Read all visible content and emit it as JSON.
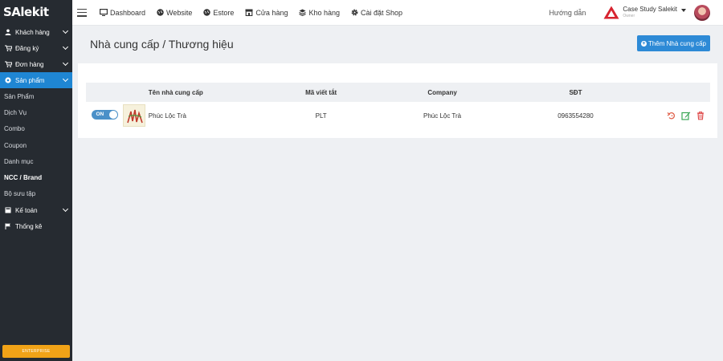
{
  "app": {
    "logo": "SAlekit"
  },
  "sidebar": {
    "items": [
      {
        "label": "Khách hàng",
        "icon": "user-icon"
      },
      {
        "label": "Đăng ký",
        "icon": "cart-icon"
      },
      {
        "label": "Đơn hàng",
        "icon": "cart-icon"
      },
      {
        "label": "Sản phẩm",
        "icon": "tag-icon",
        "active": true
      }
    ],
    "sub_items": [
      "Sản Phẩm",
      "Dịch Vụ",
      "Combo",
      "Coupon",
      "Danh mục",
      "NCC / Brand",
      "Bộ sưu tập"
    ],
    "current_sub": "NCC / Brand",
    "items_after": [
      {
        "label": "Kế toán",
        "icon": "calculator-icon"
      },
      {
        "label": "Thống kê",
        "icon": "flag-icon"
      }
    ],
    "enterprise_button": "ENTERPRISE"
  },
  "topbar": {
    "menu": [
      {
        "label": "Dashboard",
        "icon": "monitor-icon"
      },
      {
        "label": "Website",
        "icon": "globe-icon"
      },
      {
        "label": "Estore",
        "icon": "globe-icon"
      },
      {
        "label": "Cửa hàng",
        "icon": "store-icon"
      },
      {
        "label": "Kho hàng",
        "icon": "stack-icon"
      },
      {
        "label": "Cài đặt Shop",
        "icon": "gear-icon"
      }
    ],
    "help": "Hướng dẫn",
    "account_name": "Case Study Salekit",
    "account_role": "Owner"
  },
  "page": {
    "title": "Nhà cung cấp / Thương hiệu",
    "add_button": "Thêm Nhà cung cấp"
  },
  "table": {
    "columns": [
      "Tên nhà cung cấp",
      "Mã viết tắt",
      "Company",
      "SĐT"
    ],
    "rows": [
      {
        "toggle": "ON",
        "name": "Phúc Lộc Trà",
        "code": "PLT",
        "company": "Phúc Lộc Trà",
        "phone": "0963554280"
      }
    ]
  },
  "colors": {
    "sidebar_bg": "#262b31",
    "accent": "#1f86d3",
    "enterprise": "#f1a317",
    "delete": "#e05252",
    "edit": "#3aa655",
    "undo": "#e0604a"
  }
}
